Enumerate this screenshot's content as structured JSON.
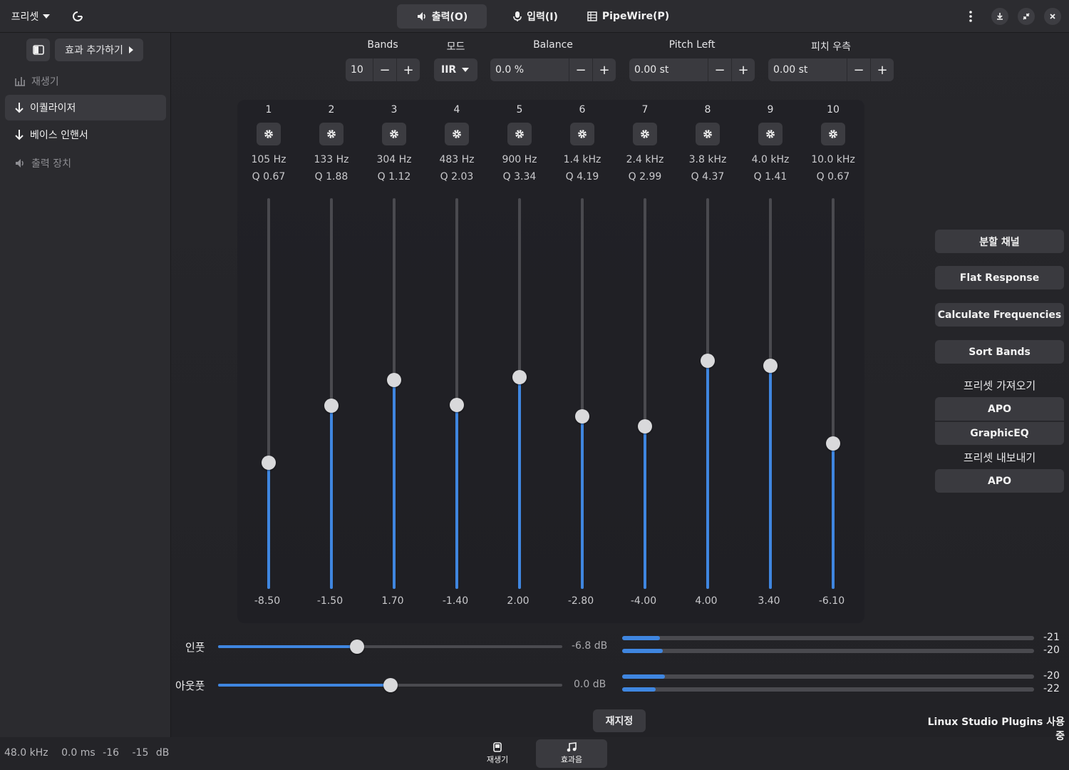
{
  "header": {
    "presets_label": "프리셋",
    "tabs": [
      {
        "label": "출력(O)",
        "icon": "speaker-icon",
        "active": true
      },
      {
        "label": "입력(I)",
        "icon": "microphone-icon",
        "active": false
      },
      {
        "label": "PipeWire(P)",
        "icon": "pipewire-icon",
        "active": false
      }
    ]
  },
  "sidebar": {
    "add_effect_label": "효과 추가하기",
    "items": [
      {
        "label": "재생기",
        "icon": "player-icon",
        "state": "dim"
      },
      {
        "label": "이퀄라이저",
        "icon": "arrow-down-icon",
        "state": "selected"
      },
      {
        "label": "베이스 인핸서",
        "icon": "arrow-down-icon",
        "state": "normal"
      },
      {
        "label": "출력 장치",
        "icon": "speaker-icon",
        "state": "dim"
      }
    ]
  },
  "controls": {
    "bands": {
      "label": "Bands",
      "value": "10"
    },
    "mode": {
      "label": "모드",
      "value": "IIR"
    },
    "balance": {
      "label": "Balance",
      "value": "0.0 %"
    },
    "pitch_left": {
      "label": "Pitch Left",
      "value": "0.00 st"
    },
    "pitch_right": {
      "label": "피치 우측",
      "value": "0.00 st"
    }
  },
  "eq": {
    "gain_min": -24,
    "gain_max": 24,
    "bands": [
      {
        "num": "1",
        "freq": "105 Hz",
        "q": "Q 0.67",
        "gain": -8.5,
        "gain_label": "-8.50"
      },
      {
        "num": "2",
        "freq": "133 Hz",
        "q": "Q 1.88",
        "gain": -1.5,
        "gain_label": "-1.50"
      },
      {
        "num": "3",
        "freq": "304 Hz",
        "q": "Q 1.12",
        "gain": 1.7,
        "gain_label": "1.70"
      },
      {
        "num": "4",
        "freq": "483 Hz",
        "q": "Q 2.03",
        "gain": -1.4,
        "gain_label": "-1.40"
      },
      {
        "num": "5",
        "freq": "900 Hz",
        "q": "Q 3.34",
        "gain": 2.0,
        "gain_label": "2.00"
      },
      {
        "num": "6",
        "freq": "1.4 kHz",
        "q": "Q 4.19",
        "gain": -2.8,
        "gain_label": "-2.80"
      },
      {
        "num": "7",
        "freq": "2.4 kHz",
        "q": "Q 2.99",
        "gain": -4.0,
        "gain_label": "-4.00"
      },
      {
        "num": "8",
        "freq": "3.8 kHz",
        "q": "Q 4.37",
        "gain": 4.0,
        "gain_label": "4.00"
      },
      {
        "num": "9",
        "freq": "4.0 kHz",
        "q": "Q 1.41",
        "gain": 3.4,
        "gain_label": "3.40"
      },
      {
        "num": "10",
        "freq": "10.0 kHz",
        "q": "Q 0.67",
        "gain": -6.1,
        "gain_label": "-6.10"
      }
    ]
  },
  "right_panel": {
    "split_channels": "분할 채널",
    "flat_response": "Flat Response",
    "calculate_frequencies": "Calculate Frequencies",
    "sort_bands": "Sort Bands",
    "import_caption": "프리셋 가져오기",
    "import_apo": "APO",
    "import_graphiceq": "GraphicEQ",
    "export_caption": "프리셋 내보내기",
    "export_apo": "APO"
  },
  "gains": {
    "input": {
      "label": "인풋",
      "value_text": "-6.8 dB",
      "fraction": 0.403
    },
    "output": {
      "label": "아웃풋",
      "value_text": "0.0 dB",
      "fraction": 0.5
    },
    "meters": [
      {
        "value": "-21",
        "fraction": 0.092
      },
      {
        "value": "-20",
        "fraction": 0.099
      },
      {
        "value": "-20",
        "fraction": 0.104
      },
      {
        "value": "-22",
        "fraction": 0.081
      }
    ]
  },
  "reset_label": "재지정",
  "plugin_notice": "Linux Studio Plugins 사용 중",
  "status": {
    "rate": "48.0 kHz",
    "latency": "0.0 ms",
    "level_left": "-16",
    "level_right": "-15",
    "unit": "dB"
  },
  "bottom_tabs": [
    {
      "label": "재생기",
      "icon": "player-icon",
      "active": false
    },
    {
      "label": "효과음",
      "icon": "music-note-icon",
      "active": true
    }
  ],
  "colors": {
    "accent": "#3f86e0",
    "background": "#242428",
    "button": "#3a3a3f"
  }
}
